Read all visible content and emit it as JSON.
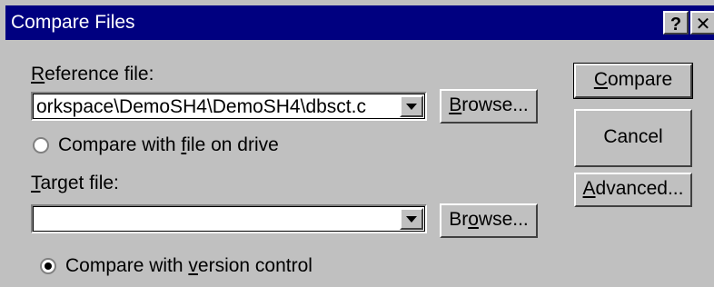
{
  "window": {
    "title": "Compare Files",
    "help_button": "?",
    "close_button": "✕"
  },
  "reference": {
    "label_mnemonic": "R",
    "label_rest": "eference file:",
    "value": "orkspace\\DemoSH4\\DemoSH4\\dbsct.c",
    "browse_mnemonic": "B",
    "browse_rest": "rowse...",
    "radio_pre": "Compare with ",
    "radio_mnemonic": "f",
    "radio_post": "ile on drive",
    "radio_selected": false
  },
  "target": {
    "label_mnemonic": "T",
    "label_rest": "arget file:",
    "value": "",
    "browse_pre": "Br",
    "browse_mnemonic": "o",
    "browse_rest": "wse...",
    "radio_pre": "Compare with ",
    "radio_mnemonic": "v",
    "radio_post": "ersion control",
    "radio_selected": true
  },
  "actions": {
    "compare_mnemonic": "C",
    "compare_rest": "ompare",
    "cancel": "Cancel",
    "advanced_mnemonic": "A",
    "advanced_rest": "dvanced..."
  }
}
